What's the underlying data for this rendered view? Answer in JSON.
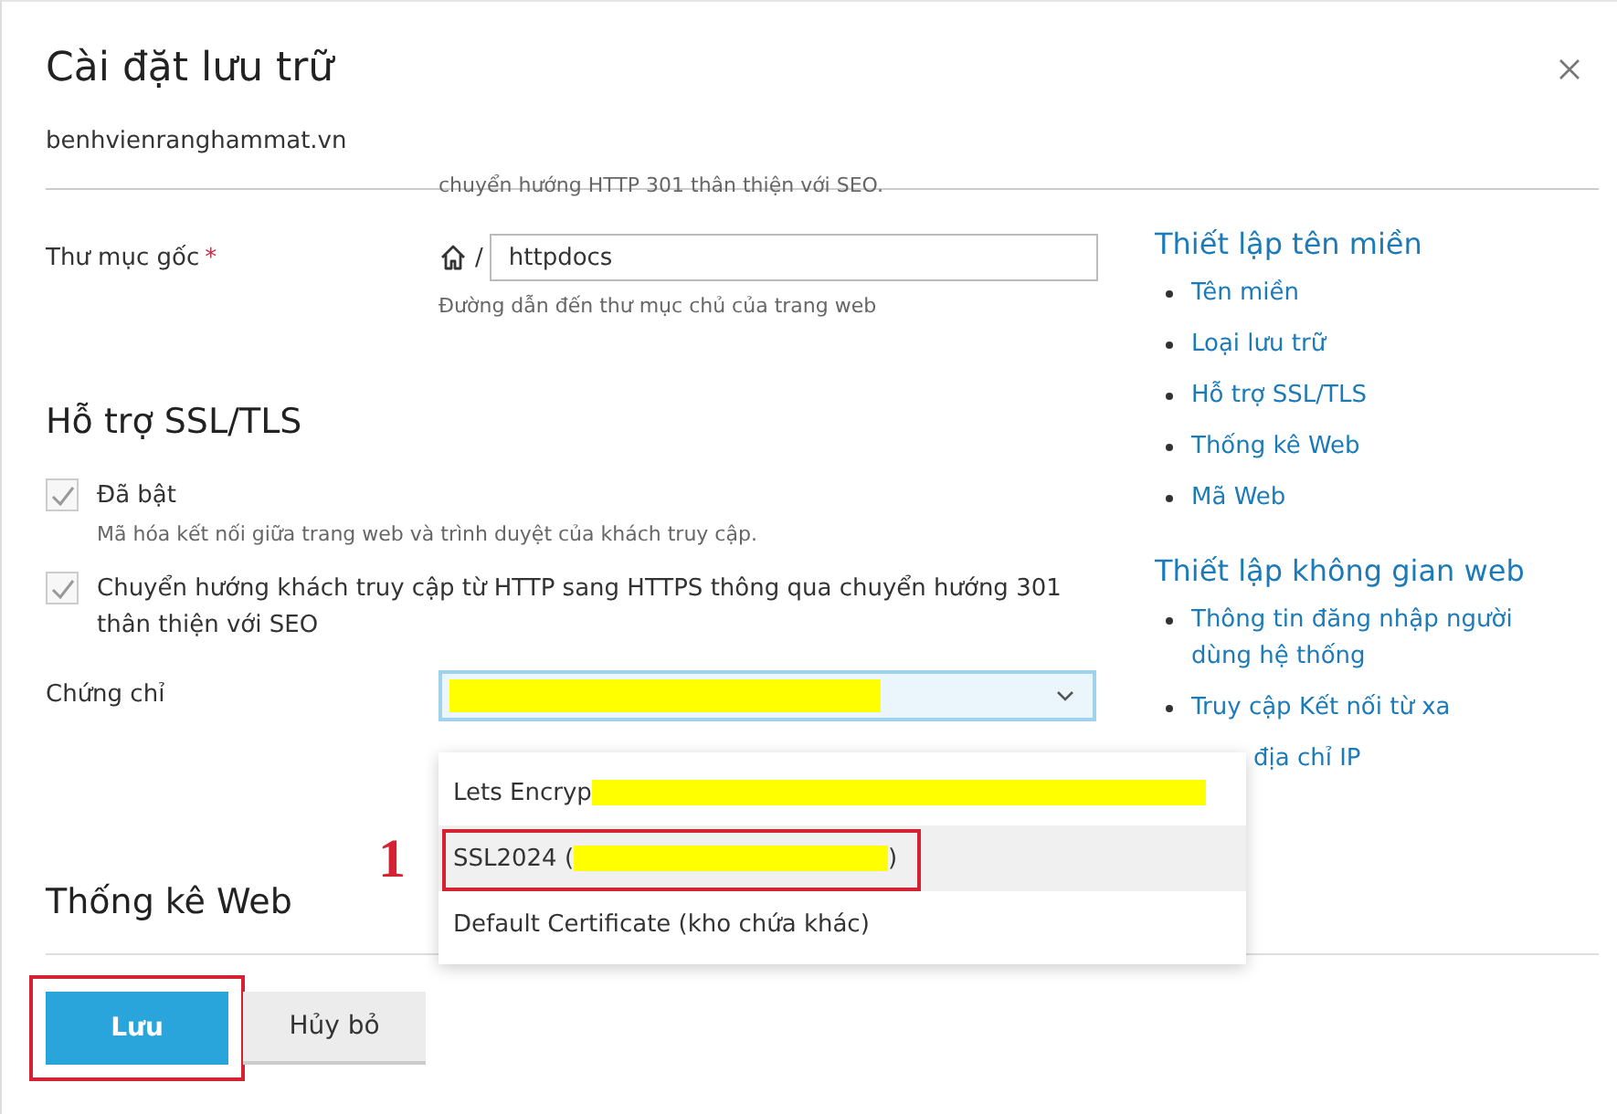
{
  "dialog": {
    "title": "Cài đặt lưu trữ",
    "subtitle": "benhvienranghammat.vn"
  },
  "cut_hint": "chuyển hướng HTTP 301 thân thiện với SEO.",
  "document_root": {
    "label": "Thư mục gốc",
    "required_mark": "*",
    "separator": "/",
    "value": "httpdocs",
    "hint": "Đường dẫn đến thư mục chủ của trang web"
  },
  "ssl_section": {
    "title": "Hỗ trợ SSL/TLS",
    "options": [
      {
        "label": "Đã bật",
        "hint": "Mã hóa kết nối giữa trang web và trình duyệt của khách truy cập.",
        "checked": true
      },
      {
        "label": "Chuyển hướng khách truy cập từ HTTP sang HTTPS thông qua chuyển hướng 301 thân thiện với SEO",
        "checked": true
      }
    ],
    "certificate": {
      "label": "Chứng chỉ",
      "redacted": true,
      "expanded": true,
      "options": [
        {
          "text": "Lets Encryp",
          "redacted": true,
          "highlighted": false
        },
        {
          "text": "SSL2024 (",
          "suffix": ")",
          "redacted": true,
          "highlighted": true,
          "annotation": "1"
        },
        {
          "text": "Default Certificate (kho chứa khác)",
          "redacted": false,
          "highlighted": false
        }
      ]
    }
  },
  "stats_section": {
    "title": "Thống kê Web"
  },
  "nav": [
    {
      "title": "Thiết lập tên miền",
      "items": [
        "Tên miền",
        "Loại lưu trữ",
        "Hỗ trợ SSL/TLS",
        "Thống kê Web",
        "Mã Web"
      ]
    },
    {
      "title": "Thiết lập không gian web",
      "items": [
        "Thông tin đăng nhập người dùng hệ thống",
        "Truy cập Kết nối từ xa"
      ],
      "partially_hidden_item": "địa chỉ IP"
    }
  ],
  "buttons": [
    {
      "label": "Lưu",
      "kind": "primary",
      "annotated": true
    },
    {
      "label": "Hủy bỏ",
      "kind": "secondary",
      "annotated": false
    }
  ]
}
